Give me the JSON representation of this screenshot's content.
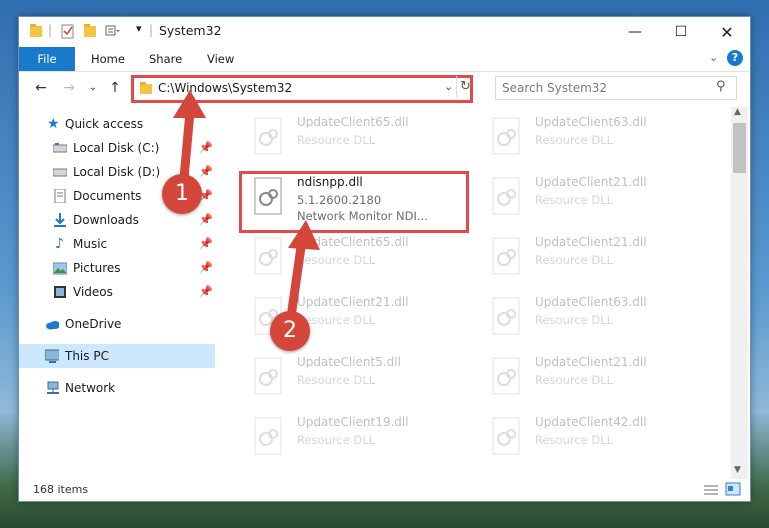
{
  "window": {
    "title": "System32",
    "tabs": [
      "File",
      "Home",
      "Share",
      "View"
    ]
  },
  "address": {
    "path": "C:\\Windows\\System32",
    "search_placeholder": "Search System32"
  },
  "sidebar": {
    "quick_access": "Quick access",
    "items": [
      {
        "label": "Local Disk (C:)",
        "icon": "drive-icon"
      },
      {
        "label": "Local Disk (D:)",
        "icon": "drive-icon"
      },
      {
        "label": "Documents",
        "icon": "documents-icon"
      },
      {
        "label": "Downloads",
        "icon": "downloads-icon"
      },
      {
        "label": "Music",
        "icon": "music-icon"
      },
      {
        "label": "Pictures",
        "icon": "pictures-icon"
      },
      {
        "label": "Videos",
        "icon": "videos-icon"
      }
    ],
    "onedrive": "OneDrive",
    "thispc": "This PC",
    "network": "Network"
  },
  "files": {
    "highlighted": {
      "name": "ndisnpp.dll",
      "version": "5.1.2600.2180",
      "description": "Network Monitor NDI..."
    },
    "faded": [
      {
        "name": "UpdateClient65.dll",
        "type": "Resource DLL"
      },
      {
        "name": "UpdateClient63.dll",
        "type": "Resource DLL"
      },
      {
        "name": "UpdateClient21.dll",
        "type": "Resource DLL"
      },
      {
        "name": "UpdateClient65.dll",
        "type": "Resource DLL"
      },
      {
        "name": "UpdateClient21.dll",
        "type": "Resource DLL"
      },
      {
        "name": "UpdateClient21.dll",
        "type": "Resource DLL"
      },
      {
        "name": "UpdateClient63.dll",
        "type": "Resource DLL"
      },
      {
        "name": "UpdateClient5.dll",
        "type": "Resource DLL"
      },
      {
        "name": "UpdateClient21.dll",
        "type": "Resource DLL"
      },
      {
        "name": "UpdateClient19.dll",
        "type": "Resource DLL"
      },
      {
        "name": "UpdateClient42.dll",
        "type": "Resource DLL"
      }
    ]
  },
  "status": {
    "item_count": "168 items"
  },
  "annotations": {
    "step1": "1",
    "step2": "2"
  },
  "colors": {
    "accent": "#1979ca",
    "highlight": "#e24b4b",
    "marker": "#d4463a",
    "selected": "#cce8ff"
  }
}
